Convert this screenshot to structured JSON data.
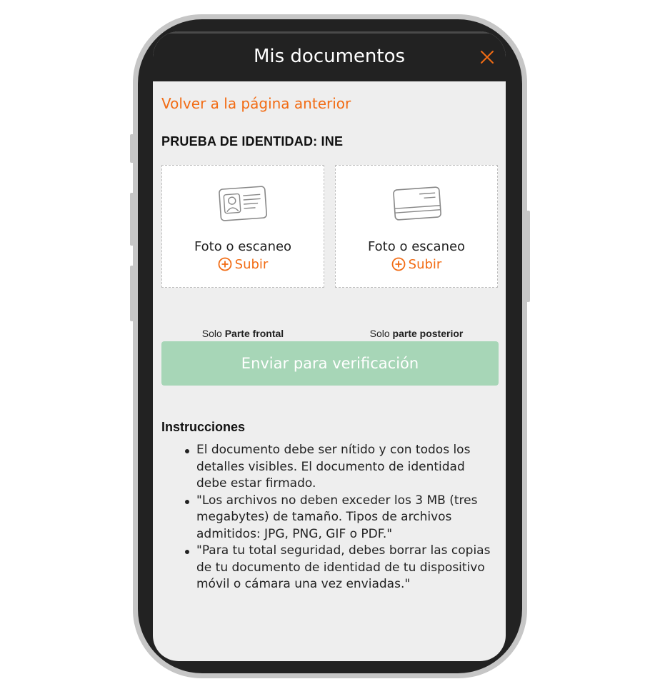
{
  "header": {
    "title": "Mis documentos",
    "close_icon": "close-icon"
  },
  "back_link": "Volver a la página anterior",
  "section_title": "PRUEBA DE IDENTIDAD: INE",
  "cards": [
    {
      "icon": "id-card-front-icon",
      "label": "Foto o escaneo",
      "upload_label": "Subir",
      "caption_prefix": "Solo",
      "caption_bold": "Parte frontal"
    },
    {
      "icon": "id-card-back-icon",
      "label": "Foto o escaneo",
      "upload_label": "Subir",
      "caption_prefix": "Solo",
      "caption_bold": "parte posterior"
    }
  ],
  "submit_button": "Enviar para verificación",
  "instructions": {
    "title": "Instrucciones",
    "items": [
      "El documento debe ser nítido y con todos los detalles visibles. El documento de identidad debe estar firmado.",
      "\"Los archivos no deben exceder los 3 MB (tres megabytes) de tamaño. Tipos de archivos admitidos: JPG, PNG, GIF o PDF.\"",
      "\"Para tu total seguridad, debes borrar las copias de tu documento de identidad de tu dispositivo móvil o cámara una vez enviadas.\""
    ]
  },
  "colors": {
    "accent": "#f26c14",
    "header_bg": "#222222",
    "screen_bg": "#eeeeee",
    "submit_disabled": "#a7d6b7"
  }
}
